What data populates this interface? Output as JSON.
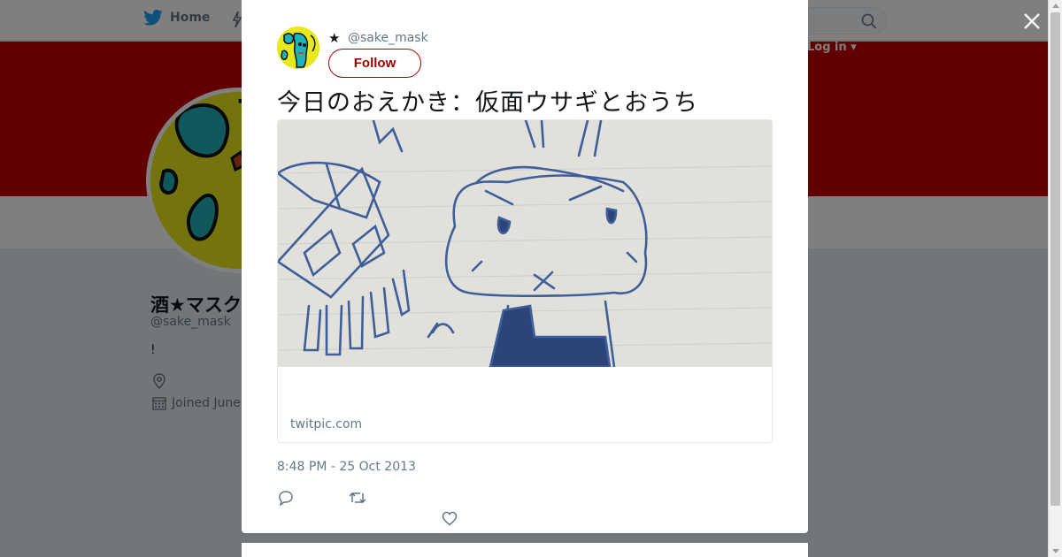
{
  "nav": {
    "home_label": "Home",
    "login_label": "Log in ▾"
  },
  "profile": {
    "name": "酒★マスク",
    "handle": "@sake_mask",
    "bio": "!",
    "joined": "Joined June"
  },
  "tweet": {
    "author_star": "★",
    "handle": "@sake_mask",
    "follow_label": "Follow",
    "text": "今日のおえかき：仮面ウサギとおうち",
    "card_domain": "twitpic.com",
    "timestamp": "8:48 PM - 25 Oct 2013"
  },
  "colors": {
    "banner": "#c00000",
    "accent": "#9b0000",
    "avatar_bg": "#e7e91a"
  },
  "icons": [
    "twitter-bird-icon",
    "moments-icon",
    "search-icon",
    "close-icon",
    "location-icon",
    "calendar-icon",
    "reply-icon",
    "retweet-icon",
    "heart-icon"
  ]
}
